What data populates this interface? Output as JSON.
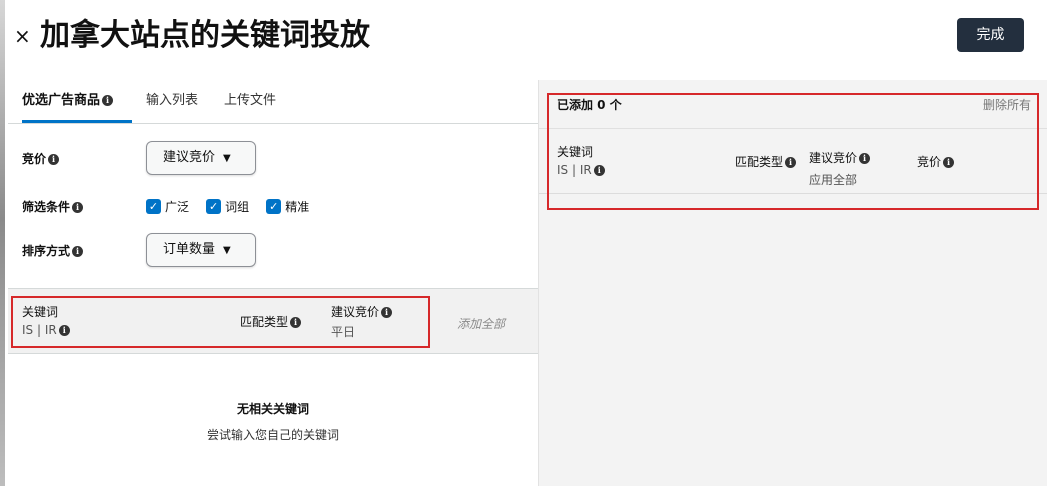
{
  "header": {
    "close_glyph": "×",
    "title": "加拿大站点的关键词投放",
    "done_label": "完成"
  },
  "tabs": [
    {
      "label": "优选广告商品",
      "active": true,
      "info": true
    },
    {
      "label": "输入列表",
      "active": false
    },
    {
      "label": "上传文件",
      "active": false
    }
  ],
  "filters": {
    "bid_label": "竞价",
    "bid_dropdown": "建议竞价",
    "filter_label": "筛选条件",
    "checkboxes": [
      {
        "label": "广泛",
        "checked": true
      },
      {
        "label": "词组",
        "checked": true
      },
      {
        "label": "精准",
        "checked": true
      }
    ],
    "sort_label": "排序方式",
    "sort_dropdown": "订单数量"
  },
  "left_table": {
    "col_keyword": "关键词",
    "col_keyword_sub": "IS | IR",
    "col_match": "匹配类型",
    "col_suggested_bid": "建议竞价",
    "col_suggested_bid_sub": "平日",
    "add_all": "添加全部"
  },
  "empty_state": {
    "title": "无相关关键词",
    "subtitle": "尝试输入您自己的关键词"
  },
  "right_panel": {
    "added_label": "已添加 0 个",
    "delete_all": "删除所有",
    "col_keyword": "关键词",
    "col_keyword_sub": "IS | IR",
    "col_match": "匹配类型",
    "col_suggested_bid": "建议竞价",
    "col_suggested_bid_sub": "应用全部",
    "col_bid": "竞价"
  },
  "icons": {
    "info": "info-icon",
    "close": "close-icon",
    "chevron": "chevron-down-icon",
    "check": "checkmark-icon"
  },
  "colors": {
    "accent_blue": "#0073c7",
    "done_button_bg": "#232f3e",
    "highlight_red": "#d6282a"
  }
}
